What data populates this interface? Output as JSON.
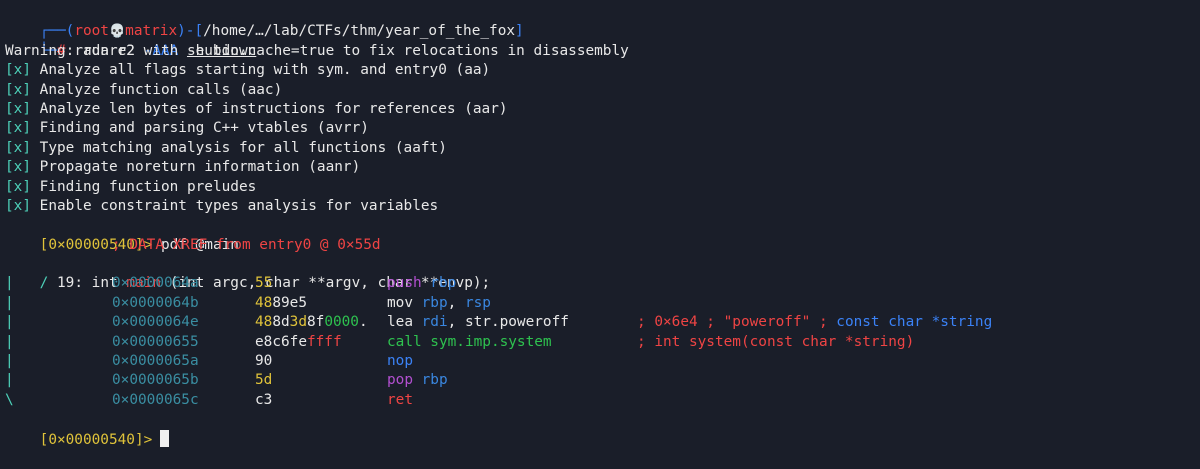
{
  "prompt": {
    "corner_top": "┌──(",
    "user": "root",
    "skull": "💀",
    "host": "matrix",
    "mid": ")-[",
    "path": "/home/…/lab/CTFs/thm/year_of_the_fox",
    "end": "]",
    "corner_bottom": "└─",
    "hash": "#",
    "command": "radare2",
    "flag": "-AAA",
    "argument": "shutdown"
  },
  "warning": "Warning: run r2 with -e bin.cache=true to fix relocations in disassembly",
  "analysis_marker": "[x]",
  "analysis": [
    "Analyze all flags starting with sym. and entry0 (aa)",
    "Analyze function calls (aac)",
    "Analyze len bytes of instructions for references (aar)",
    "Finding and parsing C++ vtables (avrr)",
    "Type matching analysis for all functions (aaft)",
    "Propagate noreturn information (aanr)",
    "Finding function preludes",
    "Enable constraint types analysis for variables"
  ],
  "r2_prompt": {
    "address": "[0×00000540]>",
    "command": "pdf @main"
  },
  "xref": "; DATA XREF from entry0 @ 0×55d",
  "function_header": {
    "marker": "/",
    "size": "19: int",
    "name": "main",
    "args": "(int argc, char **argv, char **envp);"
  },
  "instructions": [
    {
      "marker": "|",
      "addr": "0×0000064a",
      "bytes": [
        {
          "t": "55",
          "c": "y"
        }
      ],
      "mnemonic": "push",
      "mnemonic_color": "p",
      "ops": [
        {
          "t": "rbp",
          "c": "bl"
        }
      ],
      "comment": []
    },
    {
      "marker": "|",
      "addr": "0×0000064b",
      "bytes": [
        {
          "t": "48",
          "c": "y"
        },
        {
          "t": "89e5",
          "c": "w"
        }
      ],
      "mnemonic": "mov",
      "mnemonic_color": "w",
      "ops": [
        {
          "t": "rbp",
          "c": "bl"
        },
        {
          "t": ", ",
          "c": "w"
        },
        {
          "t": "rsp",
          "c": "bl"
        }
      ],
      "comment": []
    },
    {
      "marker": "|",
      "addr": "0×0000064e",
      "bytes": [
        {
          "t": "48",
          "c": "y"
        },
        {
          "t": "8d",
          "c": "w"
        },
        {
          "t": "3d",
          "c": "y"
        },
        {
          "t": "8f",
          "c": "w"
        },
        {
          "t": "0000",
          "c": "g"
        },
        {
          "t": ".",
          "c": "w"
        }
      ],
      "mnemonic": "lea",
      "mnemonic_color": "w",
      "ops": [
        {
          "t": "rdi",
          "c": "bl"
        },
        {
          "t": ", ",
          "c": "w"
        },
        {
          "t": "str.poweroff",
          "c": "w"
        }
      ],
      "comment": [
        {
          "t": "; 0×6e4 ; \"poweroff\" ; ",
          "c": "rd"
        },
        {
          "t": "const char *string",
          "c": "b"
        }
      ]
    },
    {
      "marker": "|",
      "addr": "0×00000655",
      "bytes": [
        {
          "t": "e8c6fe",
          "c": "w"
        },
        {
          "t": "ffff",
          "c": "rd"
        }
      ],
      "mnemonic": "call",
      "mnemonic_color": "g",
      "ops": [
        {
          "t": "sym.imp.system",
          "c": "g"
        }
      ],
      "comment": [
        {
          "t": "; int system(const char *string)",
          "c": "rd"
        }
      ]
    },
    {
      "marker": "|",
      "addr": "0×0000065a",
      "bytes": [
        {
          "t": "90",
          "c": "w"
        }
      ],
      "mnemonic": "nop",
      "mnemonic_color": "b",
      "ops": [],
      "comment": []
    },
    {
      "marker": "|",
      "addr": "0×0000065b",
      "bytes": [
        {
          "t": "5d",
          "c": "y"
        }
      ],
      "mnemonic": "pop",
      "mnemonic_color": "p",
      "ops": [
        {
          "t": "rbp",
          "c": "bl"
        }
      ],
      "comment": []
    },
    {
      "marker": "\\",
      "addr": "0×0000065c",
      "bytes": [
        {
          "t": "c3",
          "c": "w"
        }
      ],
      "mnemonic": "ret",
      "mnemonic_color": "rd",
      "ops": [],
      "comment": []
    }
  ],
  "final_prompt": "[0×00000540]>"
}
